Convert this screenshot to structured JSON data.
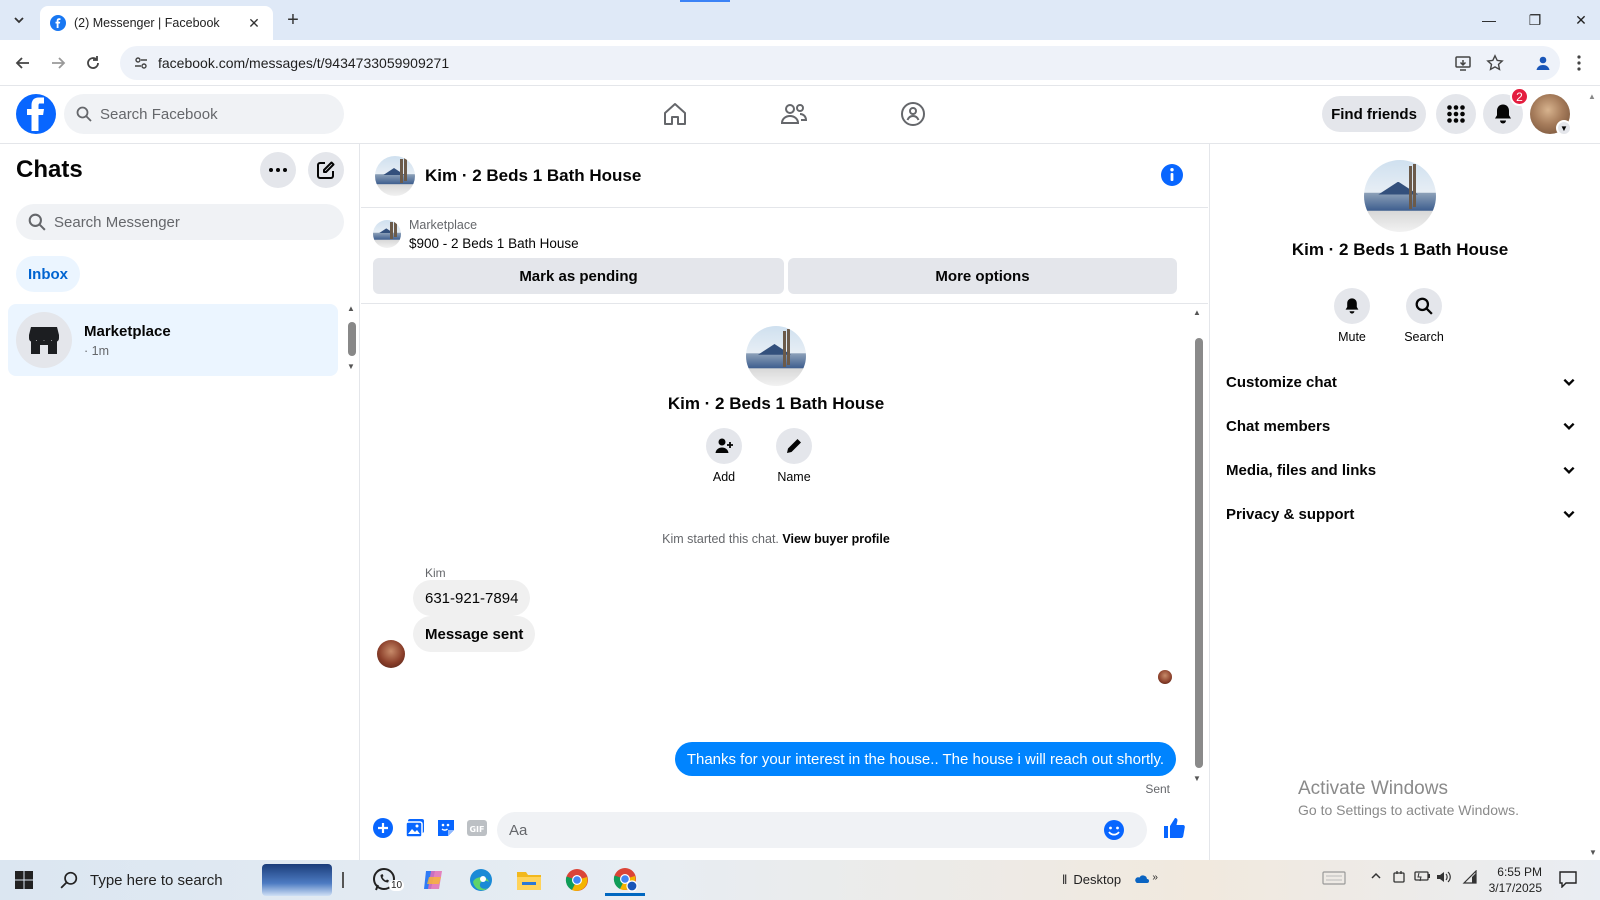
{
  "browser": {
    "tab_title": "(2) Messenger | Facebook",
    "url": "facebook.com/messages/t/9434733059909271",
    "controls": {
      "minimize": "—",
      "maximize": "❐",
      "close": "✕",
      "tab_close": "✕",
      "new_tab": "+"
    }
  },
  "fb_header": {
    "logo": "f",
    "search_placeholder": "Search Facebook",
    "find_friends_label": "Find friends",
    "notification_count": "2"
  },
  "left_panel": {
    "title": "Chats",
    "search_placeholder": "Search Messenger",
    "inbox_label": "Inbox",
    "conversations": [
      {
        "name": "Marketplace",
        "time": "· 1m"
      }
    ]
  },
  "conversation": {
    "title": "Kim · 2 Beds 1 Bath House",
    "marketplace_label": "Marketplace",
    "listing": "$900 - 2 Beds 1 Bath House",
    "mark_pending_label": "Mark as pending",
    "more_options_label": "More options",
    "thread_name": "Kim · 2 Beds 1 Bath House",
    "actions": [
      {
        "label": "Add"
      },
      {
        "label": "Name"
      }
    ],
    "started_text": "Kim started this chat.",
    "buyer_profile_link": "View buyer profile",
    "sender_name": "Kim",
    "incoming_messages": [
      "631-921-7894",
      "Message sent"
    ],
    "outgoing_message": "Thanks for your interest in the house.. The house i will reach  out shortly.",
    "sent_status": "Sent",
    "composer_placeholder": "Aa"
  },
  "right_panel": {
    "name": "Kim · 2 Beds 1 Bath House",
    "actions": [
      {
        "label": "Mute"
      },
      {
        "label": "Search"
      }
    ],
    "sections": [
      "Customize chat",
      "Chat members",
      "Media, files and links",
      "Privacy & support"
    ],
    "watermark_title": "Activate Windows",
    "watermark_sub": "Go to Settings to activate Windows."
  },
  "taskbar": {
    "search_placeholder": "Type here to search",
    "whatsapp_badge": "10",
    "desktop_label": "Desktop",
    "time": "6:55 PM",
    "date": "3/17/2025"
  }
}
